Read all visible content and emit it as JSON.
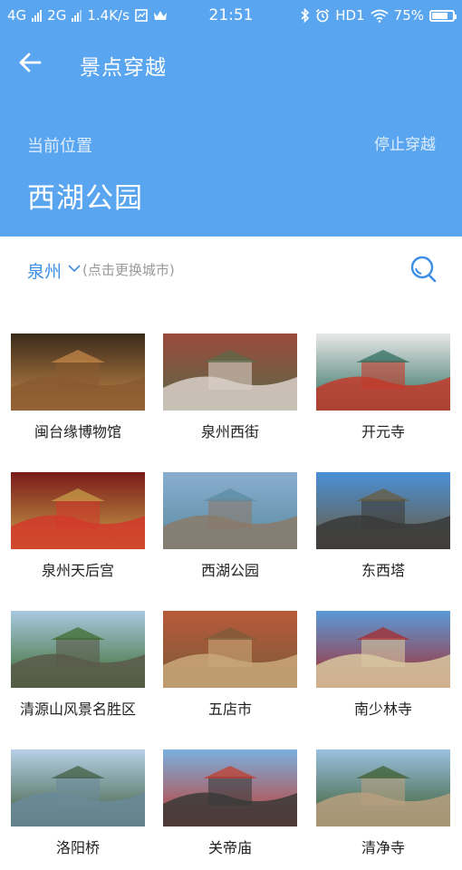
{
  "status_bar": {
    "network1": "4G",
    "network2": "2G",
    "speed": "1.4K/s",
    "time": "21:51",
    "hd": "HD1",
    "battery": "75%",
    "battery_level": 0.75
  },
  "header": {
    "title": "景点穿越",
    "current_location_label": "当前位置",
    "stop_button": "停止穿越",
    "current_location": "西湖公园"
  },
  "city_selector": {
    "city": "泉州",
    "hint": "(点击更换城市)"
  },
  "attractions": [
    {
      "name": "闽台缘博物馆",
      "colors": [
        "#3a2a1a",
        "#8a5a30",
        "#c98a4a"
      ]
    },
    {
      "name": "泉州西街",
      "colors": [
        "#9a4a3a",
        "#d9d0c8",
        "#5a6a4a"
      ]
    },
    {
      "name": "开元寺",
      "colors": [
        "#e8e8e8",
        "#c23b2a",
        "#2a6a5a"
      ]
    },
    {
      "name": "泉州天后宫",
      "colors": [
        "#7a1a1a",
        "#d23a2a",
        "#c9a24a"
      ]
    },
    {
      "name": "西湖公园",
      "colors": [
        "#8aaed0",
        "#8a7a6a",
        "#5a8aa0"
      ]
    },
    {
      "name": "东西塔",
      "colors": [
        "#4a90d8",
        "#3a3a3a",
        "#6a5a3a"
      ]
    },
    {
      "name": "清源山风景名胜区",
      "colors": [
        "#a8c8e0",
        "#5a5a4a",
        "#3a6a2a"
      ]
    },
    {
      "name": "五店市",
      "colors": [
        "#b85a3a",
        "#c9a87a",
        "#7a5a3a"
      ]
    },
    {
      "name": "南少林寺",
      "colors": [
        "#5a9ad8",
        "#d8c8a0",
        "#a82a2a"
      ]
    },
    {
      "name": "洛阳桥",
      "colors": [
        "#b8d0e8",
        "#6a8a9a",
        "#3a5a3a"
      ]
    },
    {
      "name": "关帝庙",
      "colors": [
        "#7ab0e0",
        "#3a3a3a",
        "#c23a2a"
      ]
    },
    {
      "name": "清净寺",
      "colors": [
        "#9ac0e0",
        "#b8a080",
        "#3a5a2a"
      ]
    }
  ]
}
